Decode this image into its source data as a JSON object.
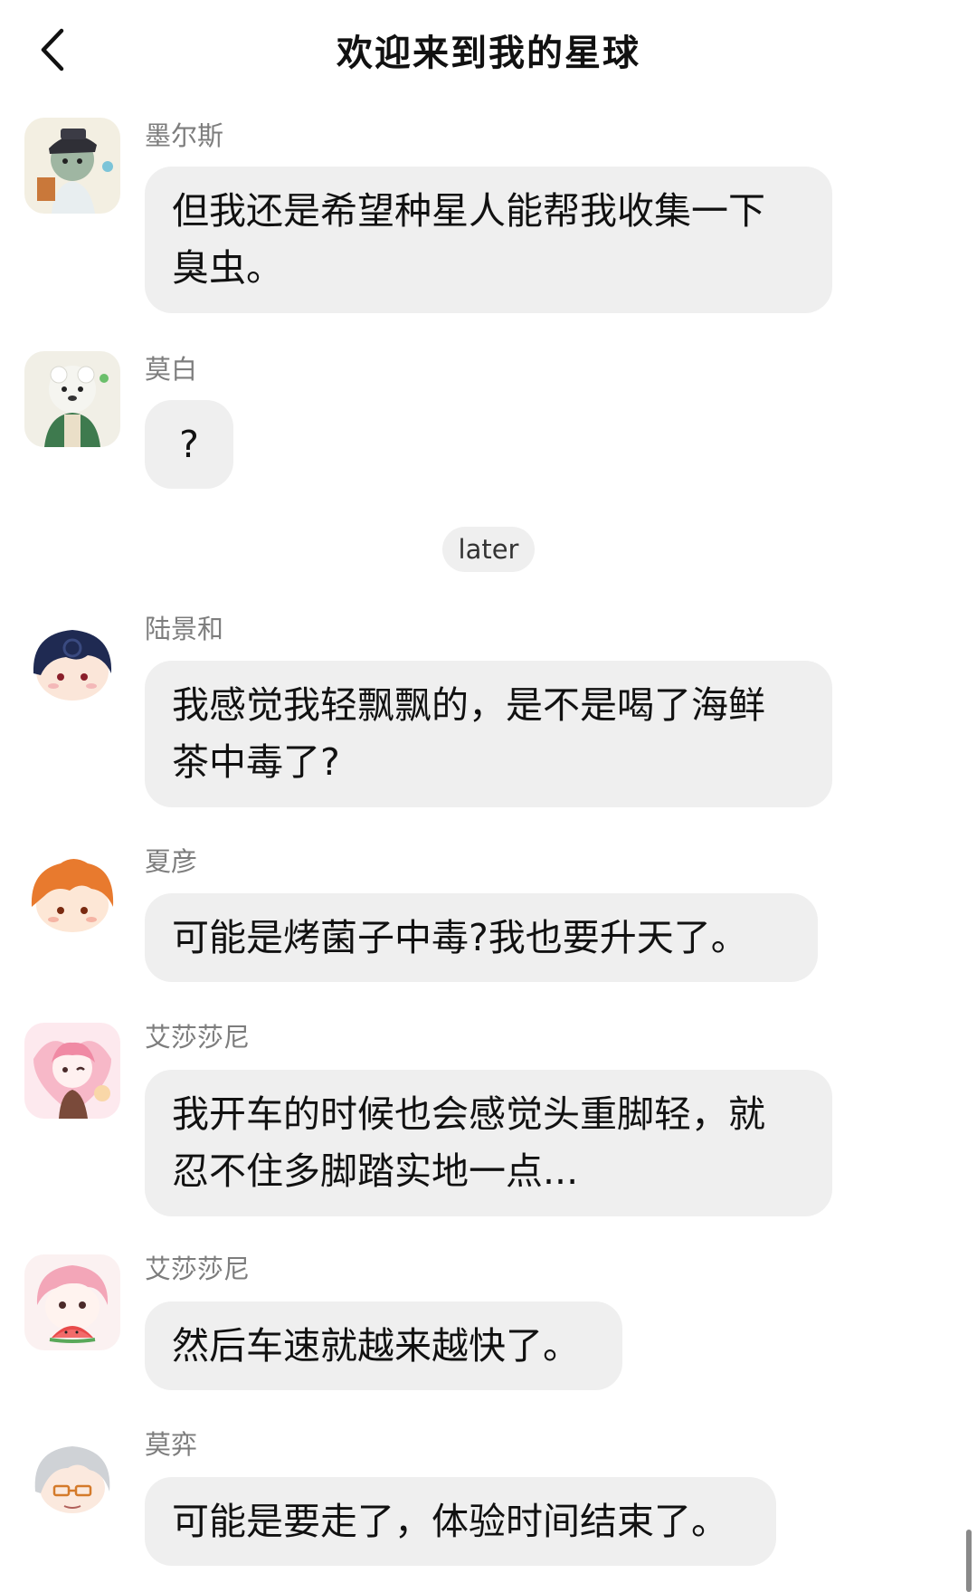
{
  "header": {
    "title": "欢迎来到我的星球",
    "back_icon": "chevron-left-icon"
  },
  "messages": [
    {
      "sender": "墨尔斯",
      "lines": [
        "但我还是希望种星人能帮我收集一下",
        "臭虫。"
      ],
      "avatar_icon": "character-avatar-icon"
    },
    {
      "sender": "莫白",
      "lines": [
        "?"
      ],
      "avatar_icon": "character-avatar-icon"
    },
    {
      "sender": "陆景和",
      "lines": [
        "我感觉我轻飘飘的，是不是喝了海鲜",
        "茶中毒了?"
      ],
      "avatar_icon": "character-avatar-icon"
    },
    {
      "sender": "夏彦",
      "lines": [
        "可能是烤菌子中毒?我也要升天了。"
      ],
      "avatar_icon": "character-avatar-icon"
    },
    {
      "sender": "艾莎莎尼",
      "lines": [
        "我开车的时候也会感觉头重脚轻，就",
        "忍不住多脚踏实地一点..."
      ],
      "avatar_icon": "character-avatar-icon"
    },
    {
      "sender": "艾莎莎尼",
      "lines": [
        "然后车速就越来越快了。"
      ],
      "avatar_icon": "character-avatar-icon"
    },
    {
      "sender": "莫弈",
      "lines": [
        "可能是要走了，体验时间结束了。"
      ],
      "avatar_icon": "character-avatar-icon"
    }
  ],
  "time_divider": "later",
  "colors": {
    "bubble_bg": "#efefef",
    "sender_name": "#7d7d7d",
    "text": "#111111",
    "background": "#ffffff"
  }
}
